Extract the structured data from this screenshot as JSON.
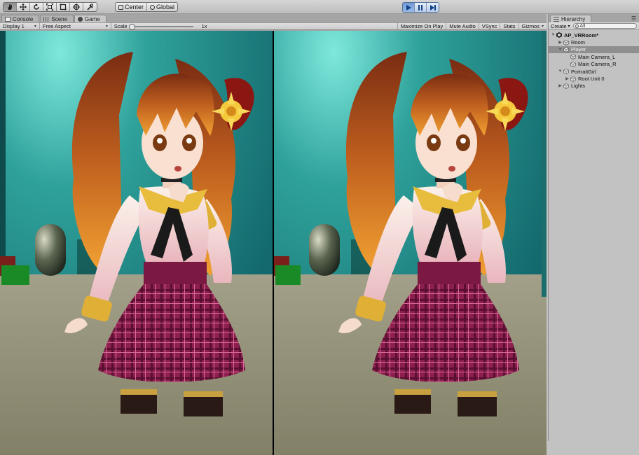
{
  "toolbar": {
    "tools": [
      {
        "name": "hand-tool",
        "icon": "hand-icon",
        "active": true
      },
      {
        "name": "move-tool",
        "icon": "move-arrows-icon",
        "active": false
      },
      {
        "name": "rotate-tool",
        "icon": "rotate-icon",
        "active": false
      },
      {
        "name": "scale-tool",
        "icon": "scale-icon",
        "active": false
      },
      {
        "name": "rect-tool",
        "icon": "rect-transform-icon",
        "active": false
      },
      {
        "name": "transform-tool",
        "icon": "transform-icon",
        "active": false
      },
      {
        "name": "custom-tool",
        "icon": "tools-icon",
        "active": false
      }
    ],
    "pivot_label": "Center",
    "space_label": "Global",
    "play_buttons": [
      "play",
      "pause",
      "step"
    ]
  },
  "tabs": [
    {
      "label": "Console",
      "icon": "console-icon"
    },
    {
      "label": "Scene",
      "icon": "scene-icon"
    },
    {
      "label": "Game",
      "icon": "game-icon"
    }
  ],
  "game_toolbar": {
    "display": "Display 1",
    "aspect": "Free Aspect",
    "scale_label": "Scale",
    "scale_value": "1x",
    "maximize_on_play": "Maximize On Play",
    "mute_audio": "Mute Audio",
    "vsync": "VSync",
    "stats": "Stats",
    "gizmos": "Gizmos"
  },
  "hierarchy": {
    "tab_label": "Hierarchy",
    "create_label": "Create",
    "search_placeholder": "All",
    "items": [
      {
        "label": "AP_VRRoom*",
        "depth": 0,
        "fold": "open",
        "type": "scene",
        "selected": false
      },
      {
        "label": "Room",
        "depth": 1,
        "fold": "closed",
        "type": "object",
        "selected": false
      },
      {
        "label": "Player",
        "depth": 1,
        "fold": "open",
        "type": "object",
        "selected": true
      },
      {
        "label": "Main Camera_L",
        "depth": 2,
        "fold": "none",
        "type": "object",
        "selected": false
      },
      {
        "label": "Main Camera_R",
        "depth": 2,
        "fold": "none",
        "type": "object",
        "selected": false
      },
      {
        "label": "PortraitGirl",
        "depth": 1,
        "fold": "open",
        "type": "object",
        "selected": false
      },
      {
        "label": "Root Unit 0",
        "depth": 2,
        "fold": "closed",
        "type": "object",
        "selected": false
      },
      {
        "label": "Lights",
        "depth": 1,
        "fold": "closed",
        "type": "object",
        "selected": false
      }
    ]
  },
  "colors": {
    "wall": "#1f8e8a",
    "floor": "#8d8a76",
    "hair": "#b85a22",
    "skirt": "#8a1e4a",
    "blouse": "#f4dcd8",
    "accent_blue": "#2f72c6"
  }
}
